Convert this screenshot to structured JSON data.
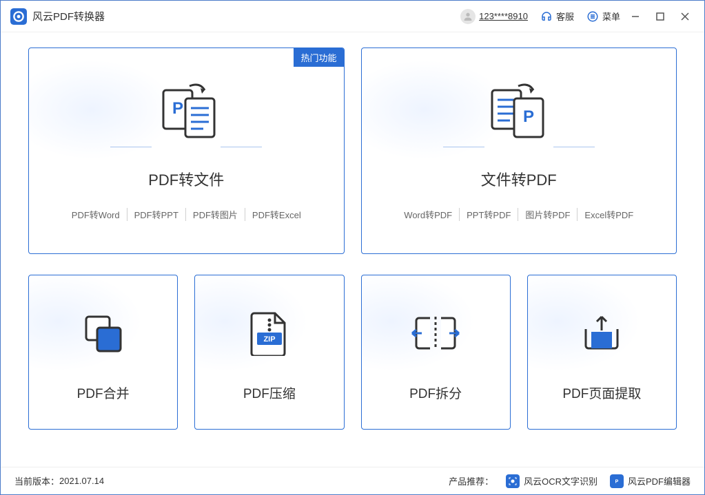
{
  "app": {
    "title": "风云PDF转换器"
  },
  "header": {
    "username": "123****8910",
    "support": "客服",
    "menu": "菜单"
  },
  "cards": {
    "hot_badge": "热门功能",
    "c1": {
      "title": "PDF转文件",
      "sub1": "PDF转Word",
      "sub2": "PDF转PPT",
      "sub3": "PDF转图片",
      "sub4": "PDF转Excel"
    },
    "c2": {
      "title": "文件转PDF",
      "sub1": "Word转PDF",
      "sub2": "PPT转PDF",
      "sub3": "图片转PDF",
      "sub4": "Excel转PDF"
    },
    "c3": {
      "title": "PDF合并"
    },
    "c4": {
      "title": "PDF压缩"
    },
    "c5": {
      "title": "PDF拆分"
    },
    "c6": {
      "title": "PDF页面提取"
    }
  },
  "footer": {
    "version_label": "当前版本：",
    "version": "2021.07.14",
    "recommend_label": "产品推荐：",
    "reco1": "风云OCR文字识别",
    "reco2": "风云PDF编辑器"
  }
}
